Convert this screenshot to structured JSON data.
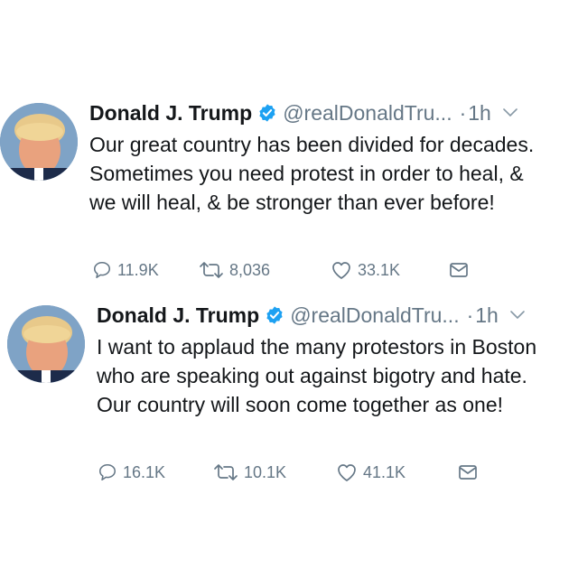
{
  "tweets": [
    {
      "author_name": "Donald J. Trump",
      "handle": "@realDonaldTru...",
      "dot": "·",
      "time": "1h",
      "text": "Our great country has been divided for decades. Sometimes you need protest in order to heal, & we will heal, & be stronger than ever before!",
      "replies": "11.9K",
      "retweets": "8,036",
      "likes": "33.1K"
    },
    {
      "author_name": "Donald J. Trump",
      "handle": "@realDonaldTru...",
      "dot": "·",
      "time": "1h",
      "text": "I want to applaud the many protestors in Boston who are speaking out against bigotry and hate. Our country will soon come together as one!",
      "replies": "16.1K",
      "retweets": "10.1K",
      "likes": "41.1K"
    }
  ],
  "colors": {
    "text": "#14171a",
    "secondary": "#657786",
    "verified": "#1da1f2",
    "background": "#ffffff"
  },
  "icons": [
    "verified-badge-icon",
    "chevron-down-icon",
    "reply-icon",
    "retweet-icon",
    "like-icon",
    "direct-message-icon"
  ]
}
